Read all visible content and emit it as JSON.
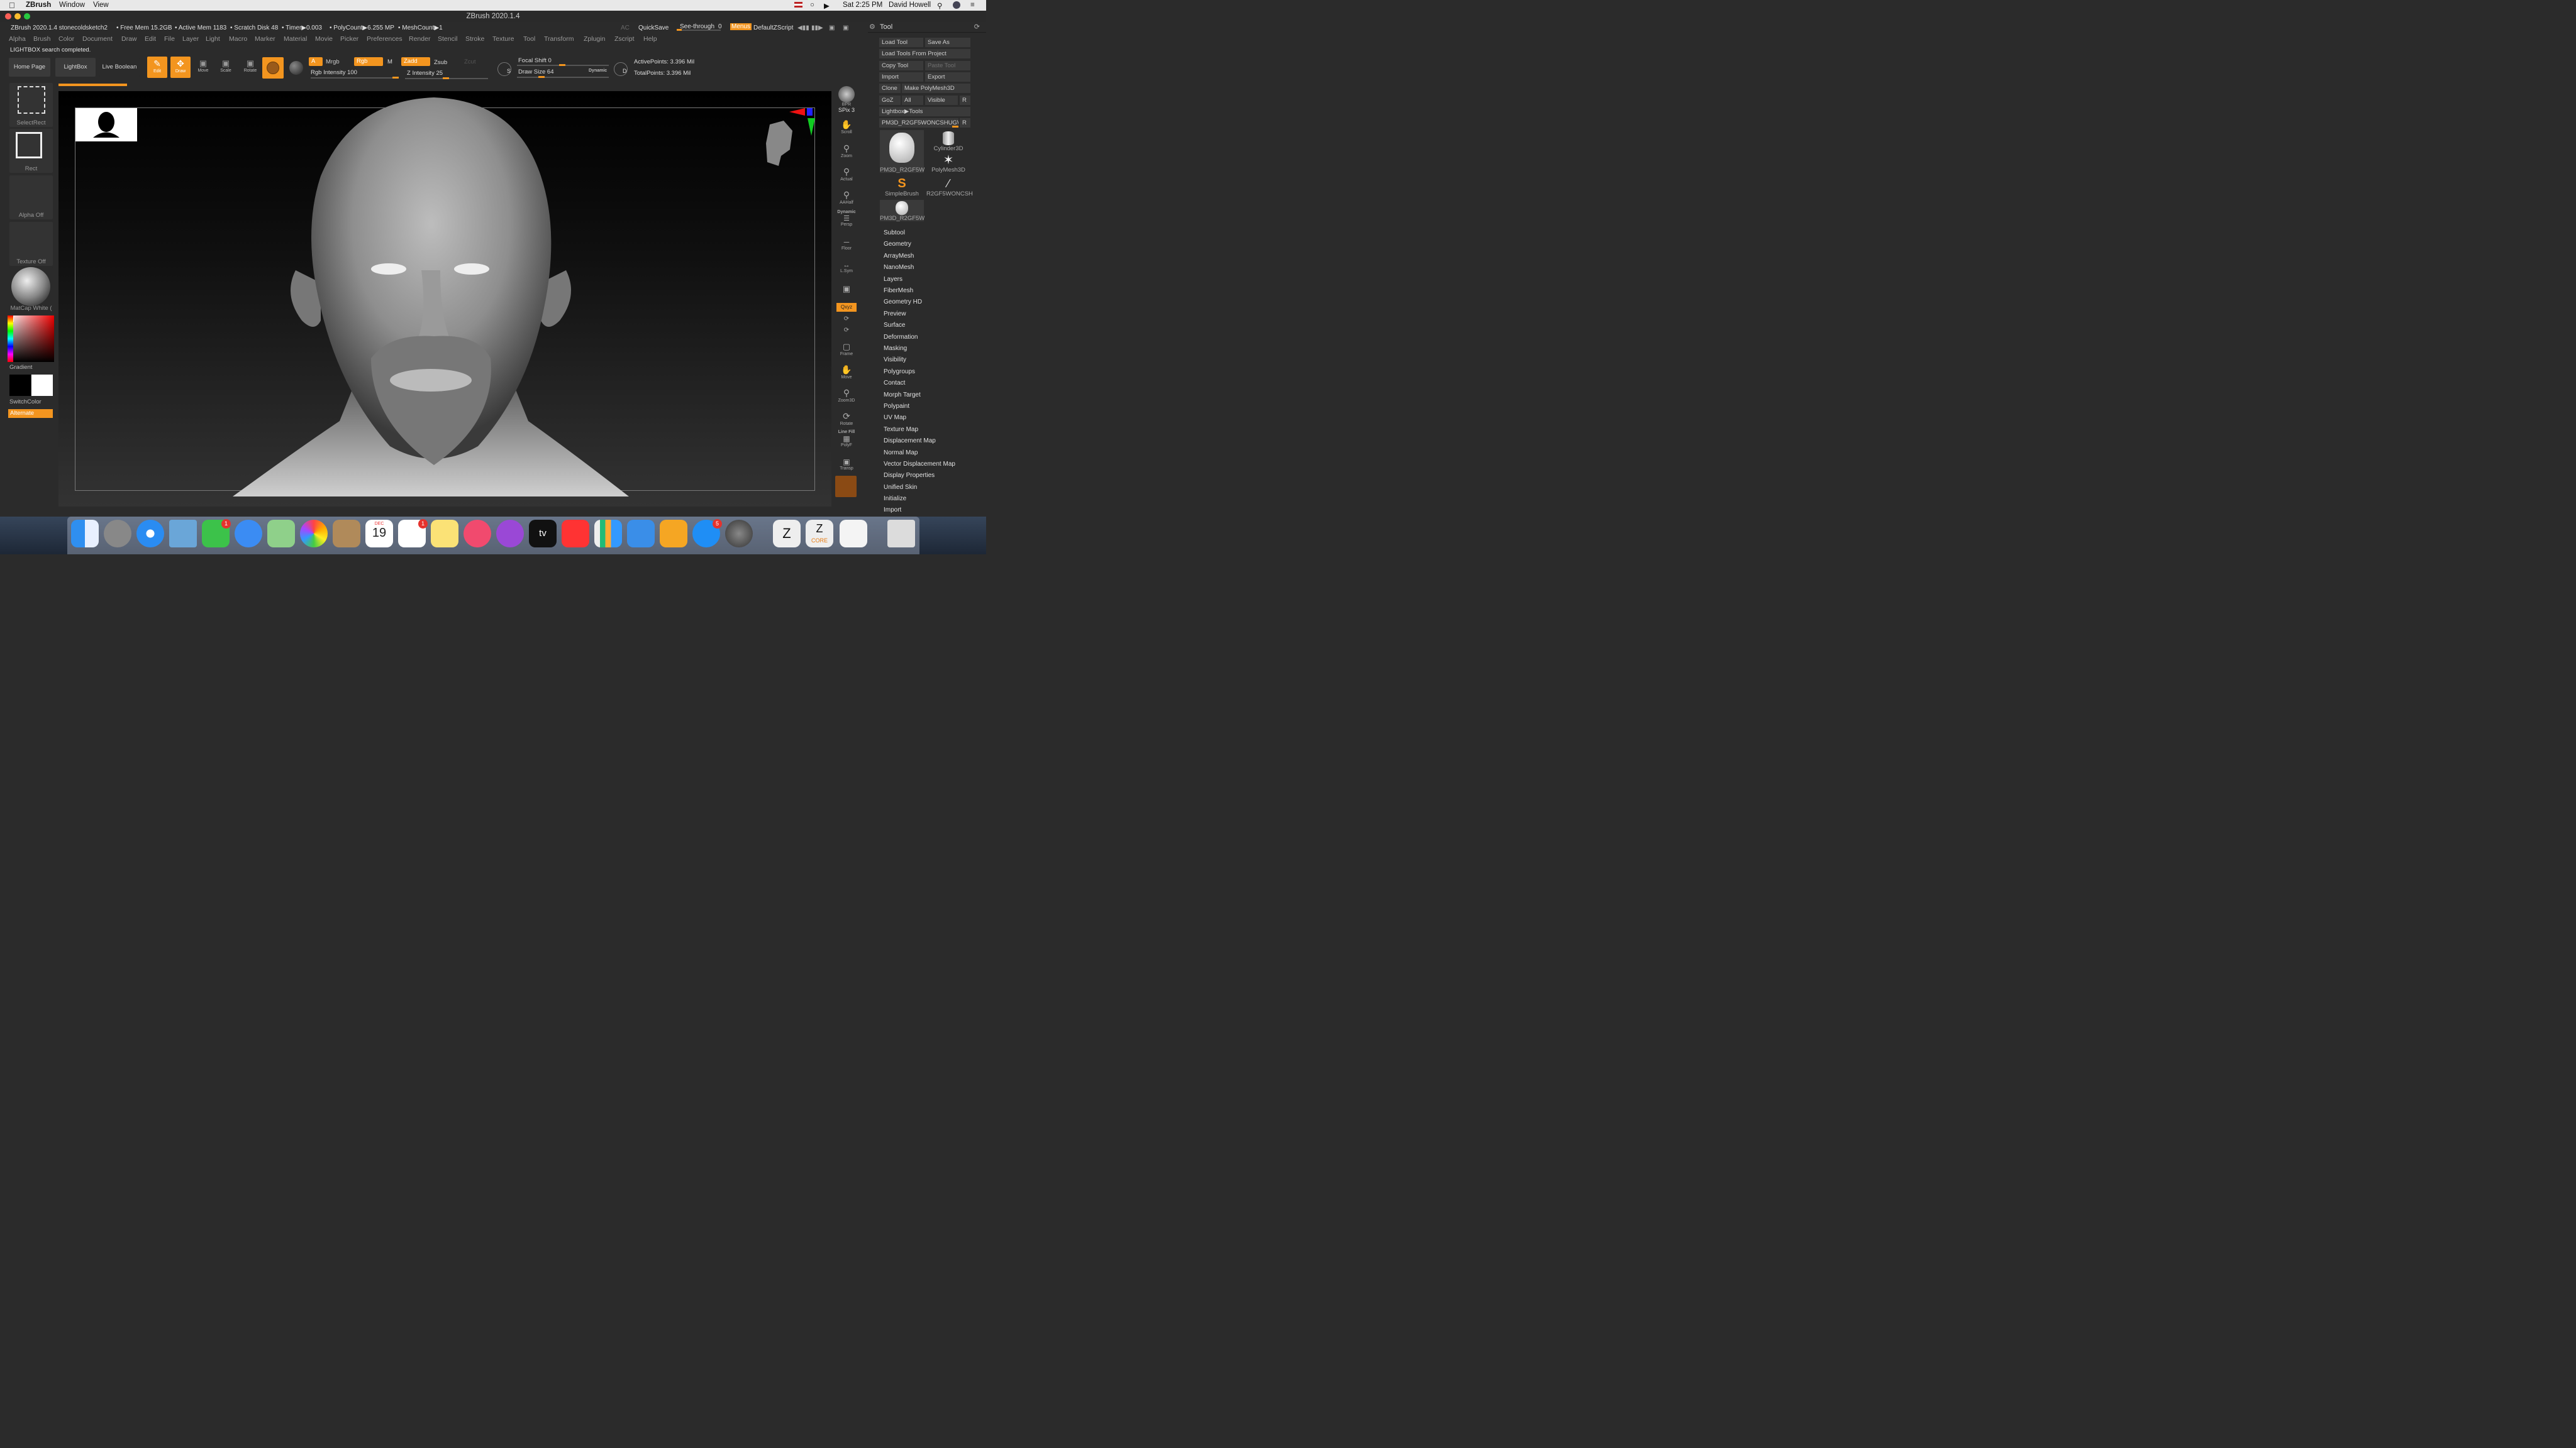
{
  "mac_menubar": {
    "app_name": "ZBrush",
    "menus": [
      "Window",
      "View"
    ],
    "clock": "Sat 2:25 PM",
    "user": "David Howell"
  },
  "window": {
    "title": "ZBrush 2020.1.4"
  },
  "status_strip": {
    "document": "ZBrush 2020.1.4 stonecoldsketch2",
    "free_mem": "• Free Mem 15.2GB",
    "active_mem": "• Active Mem 1183",
    "scratch_disk": "• Scratch Disk 48",
    "timer": "• Timer▶0.003",
    "poly_count": "• PolyCount▶6.255 MP",
    "mesh_count": "• MeshCount▶1",
    "ac": "AC",
    "quicksave": "QuickSave",
    "see_through": "See-through",
    "see_through_value": "0",
    "menus": "Menus",
    "default_zscript": "DefaultZScript"
  },
  "main_menu": [
    "Alpha",
    "Brush",
    "Color",
    "Document",
    "Draw",
    "Edit",
    "File",
    "Layer",
    "Light",
    "Macro",
    "Marker",
    "Material",
    "Movie",
    "Picker",
    "Preferences",
    "Render",
    "Stencil",
    "Stroke",
    "Texture",
    "Tool",
    "Transform",
    "Zplugin",
    "Zscript",
    "Help"
  ],
  "status_message": "LIGHTBOX search completed.",
  "top_shelf": {
    "home_page": "Home Page",
    "lightbox": "LightBox",
    "live_boolean": "Live Boolean",
    "edit": "Edit",
    "draw": "Draw",
    "move": "Move",
    "scale": "Scale",
    "rotate": "Rotate",
    "a": "A",
    "mrgb": "Mrgb",
    "rgb": "Rgb",
    "m": "M",
    "zadd": "Zadd",
    "zsub": "Zsub",
    "zcut": "Zcut",
    "rgb_intensity": "Rgb Intensity 100",
    "z_intensity": "Z Intensity 25",
    "focal_shift": "Focal Shift 0",
    "draw_size": "Draw Size 64",
    "dynamic": "Dynamic",
    "active_points": "ActivePoints: 3.396 Mil",
    "total_points": "TotalPoints: 3.396 Mil",
    "s": "S",
    "d": "D"
  },
  "left_shelf": {
    "select_rect": "SelectRect",
    "rect": "Rect",
    "alpha_off": "Alpha Off",
    "texture_off": "Texture Off",
    "matcap": "MatCap White (",
    "gradient": "Gradient",
    "switch_color": "SwitchColor",
    "alternate": "Alternate"
  },
  "right_shelf": {
    "bpr": "BPR",
    "spix": "SPix 3",
    "scroll": "Scroll",
    "zoom": "Zoom",
    "actual": "Actual",
    "aahalf": "AAHalf",
    "dynamic": "Dynamic",
    "persp": "Persp",
    "floor": "Floor",
    "lsym": "L.Sym",
    "xyz": "Qxyz",
    "frame": "Frame",
    "move": "Move",
    "zoom3d": "Zoom3D",
    "rotate": "Rotate",
    "line_fill": "Line Fill",
    "polyf": "PolyF",
    "transp": "Transp"
  },
  "tool_panel": {
    "title": "Tool",
    "load_tool": "Load Tool",
    "save_as": "Save As",
    "load_from_project": "Load Tools From Project",
    "copy_tool": "Copy Tool",
    "paste_tool": "Paste Tool",
    "import": "Import",
    "export": "Export",
    "clone": "Clone",
    "make_polymesh": "Make PolyMesh3D",
    "goz": "GoZ",
    "all": "All",
    "visible": "Visible",
    "r": "R",
    "lightbox_tools": "Lightbox▶Tools",
    "current_tool": "PM3D_R2GF5WONCSHUGW2",
    "tiles": [
      "PM3D_R2GF5W",
      "Cylinder3D",
      "PolyMesh3D",
      "SimpleBrush",
      "R2GF5WONCSH",
      "PM3D_R2GF5W"
    ],
    "subpalettes": [
      "Subtool",
      "Geometry",
      "ArrayMesh",
      "NanoMesh",
      "Layers",
      "FiberMesh",
      "Geometry HD",
      "Preview",
      "Surface",
      "Deformation",
      "Masking",
      "Visibility",
      "Polygroups",
      "Contact",
      "Morph Target",
      "Polypaint",
      "UV Map",
      "Texture Map",
      "Displacement Map",
      "Normal Map",
      "Vector Displacement Map",
      "Display Properties",
      "Unified Skin",
      "Initialize",
      "Import"
    ]
  },
  "dock": {
    "calendar_month": "DEC",
    "calendar_day": "19",
    "facetime_badge": "1",
    "reminders_badge": "1",
    "appstore_badge": "5",
    "tv_label": "tv",
    "core_label": "CORE"
  },
  "colors": {
    "accent": "#f3951f",
    "panel": "#2b2b2b",
    "button": "#3a3a3a"
  }
}
